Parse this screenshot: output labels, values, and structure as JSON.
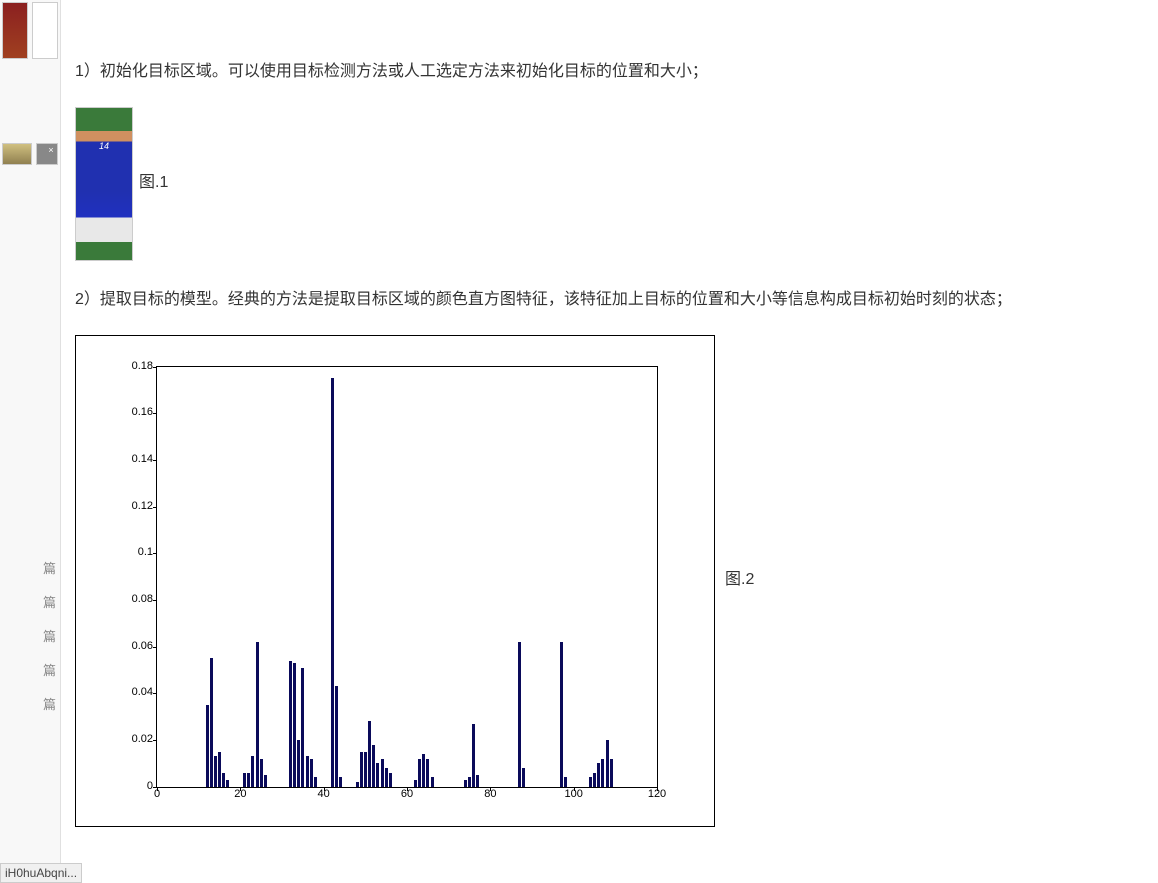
{
  "content": {
    "para1": "1）初始化目标区域。可以使用目标检测方法或人工选定方法来初始化目标的位置和大小；",
    "fig1_caption": "图.1",
    "fig1_jersey": "14",
    "para2": "2）提取目标的模型。经典的方法是提取目标区域的颜色直方图特征，该特征加上目标的位置和大小等信息构成目标初始时刻的状态；",
    "fig2_caption": "图.2"
  },
  "sidebar": {
    "item_suffix": "篇",
    "items": [
      "篇",
      "篇",
      "篇",
      "篇",
      "篇"
    ]
  },
  "statusbar": {
    "text": "iH0huAbqni..."
  },
  "chart_data": {
    "type": "bar",
    "xlabel": "",
    "ylabel": "",
    "xlim": [
      0,
      120
    ],
    "ylim": [
      0,
      0.18
    ],
    "yticks": [
      0,
      0.02,
      0.04,
      0.06,
      0.08,
      0.1,
      0.12,
      0.14,
      0.16,
      0.18
    ],
    "xticks": [
      0,
      20,
      40,
      60,
      80,
      100,
      120
    ],
    "x": [
      12,
      13,
      14,
      15,
      16,
      17,
      21,
      22,
      23,
      24,
      25,
      26,
      32,
      33,
      34,
      35,
      36,
      37,
      38,
      42,
      43,
      44,
      48,
      49,
      50,
      51,
      52,
      53,
      54,
      55,
      56,
      62,
      63,
      64,
      65,
      66,
      74,
      75,
      76,
      77,
      87,
      88,
      97,
      98,
      104,
      105,
      106,
      107,
      108,
      109
    ],
    "values": [
      0.035,
      0.055,
      0.013,
      0.015,
      0.006,
      0.003,
      0.006,
      0.006,
      0.013,
      0.062,
      0.012,
      0.005,
      0.054,
      0.053,
      0.02,
      0.051,
      0.013,
      0.012,
      0.004,
      0.175,
      0.043,
      0.004,
      0.002,
      0.015,
      0.015,
      0.028,
      0.018,
      0.01,
      0.012,
      0.008,
      0.006,
      0.003,
      0.012,
      0.014,
      0.012,
      0.004,
      0.003,
      0.004,
      0.027,
      0.005,
      0.062,
      0.008,
      0.062,
      0.004,
      0.004,
      0.006,
      0.01,
      0.012,
      0.02,
      0.012
    ]
  }
}
